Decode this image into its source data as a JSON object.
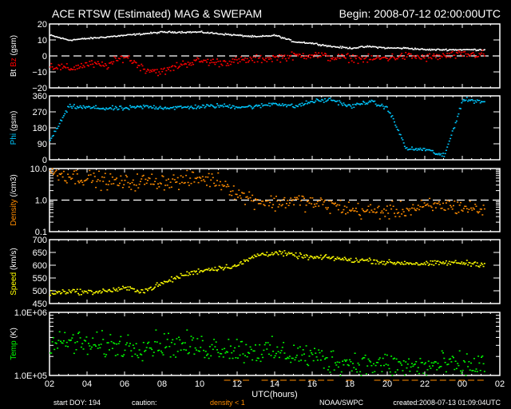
{
  "header": {
    "title": "ACE RTSW (Estimated) MAG & SWEPAM",
    "begin": "Begin: 2008-07-12 02:00:00UTC"
  },
  "footer": {
    "start_doy": "start DOY: 194",
    "caution_label": "caution:",
    "caution_value": "density < 1",
    "agency": "NOAA/SWPC",
    "created": "created:2008-07-13 01:09:04UTC"
  },
  "colors": {
    "bt": "#ffffff",
    "bz": "#ff0000",
    "phi": "#00c8ff",
    "density": "#ff8c00",
    "speed": "#ffff00",
    "temp": "#00ff00",
    "axis": "#ffffff",
    "caution": "#ff8c00"
  },
  "chart_data": {
    "type": "scatter",
    "xlabel": "UTC(hours)",
    "x_ticks": [
      "02",
      "04",
      "06",
      "08",
      "10",
      "12",
      "14",
      "16",
      "18",
      "20",
      "22",
      "00",
      "02"
    ],
    "xlim_hours": [
      0,
      24
    ],
    "panels": [
      {
        "id": "mag",
        "ylabel_parts": [
          {
            "text": "Bt",
            "color": "#ffffff"
          },
          {
            "text": " Bz",
            "color": "#ff0000"
          },
          {
            "text": "  (gsm)",
            "color": "#ffffff"
          }
        ],
        "scale": "linear",
        "ylim": [
          -20,
          20
        ],
        "y_ticks": [
          {
            "v": -20,
            "label": "−20"
          },
          {
            "v": -10,
            "label": "−10"
          },
          {
            "v": 0,
            "label": "0"
          },
          {
            "v": 10,
            "label": "10"
          },
          {
            "v": 20,
            "label": "20"
          }
        ],
        "ref_line": 0,
        "series": [
          {
            "name": "Bt",
            "color": "#ffffff",
            "jitter": 0.5,
            "hourly": [
              13,
              10,
              11,
              12,
              13,
              14,
              15,
              15,
              15,
              14,
              13,
              12,
              13,
              9,
              8,
              6,
              5,
              6,
              5,
              5,
              4,
              4,
              4,
              4
            ]
          },
          {
            "name": "Bz",
            "color": "#ff0000",
            "jitter": 2.5,
            "hourly": [
              -6,
              -8,
              -5,
              -6,
              0,
              -8,
              -10,
              -5,
              -3,
              -4,
              -3,
              -2,
              -1,
              0,
              1,
              -1,
              -1,
              -2,
              -1,
              0,
              -1,
              0,
              1,
              1
            ]
          }
        ]
      },
      {
        "id": "phi",
        "ylabel_parts": [
          {
            "text": "Phi",
            "color": "#00c8ff"
          },
          {
            "text": "  (gsm)",
            "color": "#ffffff"
          }
        ],
        "scale": "linear",
        "ylim": [
          0,
          360
        ],
        "y_ticks": [
          {
            "v": 0,
            "label": "0"
          },
          {
            "v": 90,
            "label": "90"
          },
          {
            "v": 180,
            "label": "180"
          },
          {
            "v": 270,
            "label": "270"
          },
          {
            "v": 360,
            "label": "360"
          }
        ],
        "series": [
          {
            "name": "Phi",
            "color": "#00c8ff",
            "jitter": 12,
            "hourly": [
              110,
              300,
              295,
              290,
              290,
              300,
              295,
              295,
              300,
              305,
              300,
              300,
              320,
              300,
              330,
              340,
              300,
              330,
              290,
              60,
              60,
              20,
              340,
              330
            ]
          }
        ]
      },
      {
        "id": "density",
        "ylabel_parts": [
          {
            "text": "Density",
            "color": "#ff8c00"
          },
          {
            "text": "  (/cm3)",
            "color": "#ffffff"
          }
        ],
        "scale": "log",
        "ylim": [
          0.1,
          10
        ],
        "y_ticks": [
          {
            "v": 0.1,
            "label": "0.1"
          },
          {
            "v": 1,
            "label": "1.0"
          },
          {
            "v": 10,
            "label": "10.0"
          }
        ],
        "ref_line": 1,
        "series": [
          {
            "name": "Density",
            "color": "#ff8c00",
            "jitter": 0.25,
            "hourly": [
              8,
              6,
              5,
              4,
              3.5,
              4,
              4,
              4,
              5,
              4,
              1.5,
              1,
              0.8,
              1,
              0.8,
              0.7,
              0.5,
              0.45,
              0.45,
              0.5,
              0.6,
              0.7,
              0.6,
              0.5
            ]
          }
        ]
      },
      {
        "id": "speed",
        "ylabel_parts": [
          {
            "text": "Speed",
            "color": "#ffff00"
          },
          {
            "text": "  (km/s)",
            "color": "#ffffff"
          }
        ],
        "scale": "linear",
        "ylim": [
          450,
          700
        ],
        "y_ticks": [
          {
            "v": 450,
            "label": "450"
          },
          {
            "v": 500,
            "label": "500"
          },
          {
            "v": 550,
            "label": "550"
          },
          {
            "v": 600,
            "label": "600"
          },
          {
            "v": 650,
            "label": "650"
          },
          {
            "v": 700,
            "label": "700"
          }
        ],
        "series": [
          {
            "name": "Speed",
            "color": "#ffff00",
            "jitter": 10,
            "hourly": [
              490,
              500,
              495,
              500,
              510,
              500,
              530,
              560,
              580,
              590,
              600,
              640,
              650,
              640,
              630,
              630,
              620,
              620,
              610,
              610,
              605,
              610,
              610,
              605
            ]
          }
        ]
      },
      {
        "id": "temp",
        "ylabel_parts": [
          {
            "text": "Temp",
            "color": "#00ff00"
          },
          {
            "text": "  (K)",
            "color": "#ffffff"
          }
        ],
        "scale": "log",
        "ylim": [
          100000,
          1000000
        ],
        "y_ticks": [
          {
            "v": 100000,
            "label": "1.0E+05"
          },
          {
            "v": 1000000,
            "label": "1.0E+06"
          }
        ],
        "series": [
          {
            "name": "Temp",
            "color": "#00ff00",
            "jitter": 0.2,
            "hourly": [
              300000,
              350000,
              300000,
              300000,
              300000,
              300000,
              320000,
              300000,
              280000,
              280000,
              260000,
              250000,
              230000,
              220000,
              200000,
              170000,
              160000,
              150000,
              150000,
              140000,
              140000,
              150000,
              140000,
              150000
            ]
          }
        ]
      }
    ]
  }
}
